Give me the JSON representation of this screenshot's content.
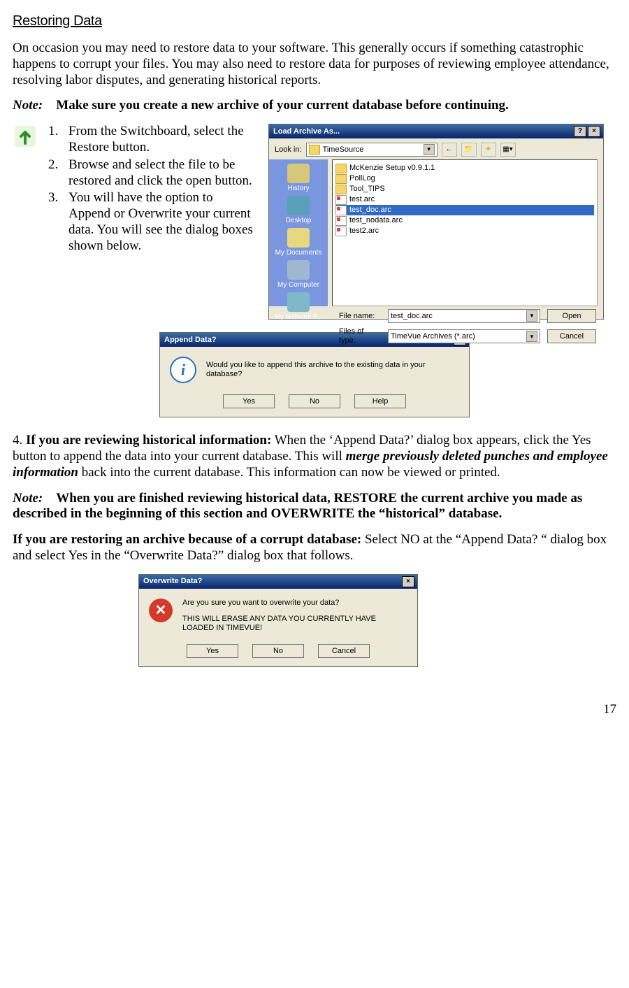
{
  "heading": "Restoring Data",
  "intro": "On occasion you may need to restore data to your software. This generally occurs if something catastrophic happens to corrupt your files. You may also need to restore data for purposes of reviewing employee attendance, resolving labor disputes, and generating historical reports.",
  "note1_label": "Note:",
  "note1_text": "Make sure you create a new archive of your current database before continuing.",
  "steps": {
    "s1": "From the Switchboard, select the Restore button.",
    "s2": "Browse and select the file to be restored and click the open button.",
    "s3": "You will have the option to Append or Overwrite your current data.  You will see the dialog boxes shown below."
  },
  "load_dlg": {
    "title": "Load Archive As...",
    "lookin_label": "Look in:",
    "lookin_value": "TimeSource",
    "places": {
      "history": "History",
      "desktop": "Desktop",
      "mydocs": "My Documents",
      "mycomp": "My Computer",
      "mynet": "My Network P..."
    },
    "files": {
      "f0": "McKenzie Setup v0.9.1.1",
      "f1": "PollLog",
      "f2": "Tool_TIPS",
      "f3": "test.arc",
      "f4": "test_doc.arc",
      "f5": "test_nodata.arc",
      "f6": "test2.arc"
    },
    "filename_label": "File name:",
    "filename_value": "test_doc.arc",
    "filetype_label": "Files of type:",
    "filetype_value": "TimeVue Archives (*.arc)",
    "open": "Open",
    "cancel": "Cancel"
  },
  "append_dlg": {
    "title": "Append Data?",
    "message": "Would you like to append this archive to the existing data in your database?",
    "yes": "Yes",
    "no": "No",
    "help": "Help"
  },
  "para4_lead": "4.  ",
  "para4_bold": "If you are reviewing historical information:",
  "para4_a": "  When the ‘Append Data?’ dialog box appears, click the Yes button to append the data into your current database.  This will ",
  "para4_em": "merge previously deleted punches and employee information",
  "para4_b": " back into the current database.  This information can now be viewed or printed.",
  "note2_label": "Note:",
  "note2_text": "When you are finished reviewing historical data, RESTORE the current archive you made as described in the beginning of this section and OVERWRITE the “historical” database.",
  "para5_bold": "If you are restoring an archive because of a corrupt database:",
  "para5_text": "  Select NO at the “Append Data? “ dialog box and select Yes in the “Overwrite Data?” dialog box that follows.",
  "over_dlg": {
    "title": "Overwrite Data?",
    "line1": "Are you sure you want to overwrite your data?",
    "line2": "THIS WILL ERASE ANY DATA YOU CURRENTLY HAVE LOADED IN TIMEVUE!",
    "yes": "Yes",
    "no": "No",
    "cancel": "Cancel"
  },
  "page_number": "17"
}
